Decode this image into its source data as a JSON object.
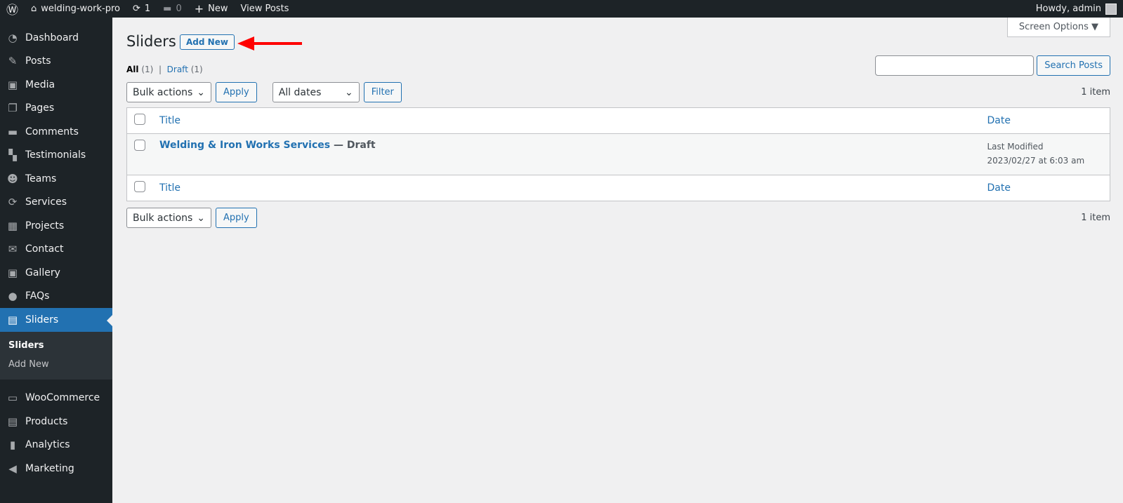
{
  "adminbar": {
    "site": "welding-work-pro",
    "updates": "1",
    "comments": "0",
    "new": "New",
    "view_posts": "View Posts",
    "howdy": "Howdy, admin"
  },
  "sidebar": {
    "items": [
      {
        "label": "Dashboard",
        "icon": "dashboard-icon",
        "glyph": "◔"
      },
      {
        "label": "Posts",
        "icon": "pin-icon",
        "glyph": "✎"
      },
      {
        "label": "Media",
        "icon": "media-icon",
        "glyph": "▣"
      },
      {
        "label": "Pages",
        "icon": "pages-icon",
        "glyph": "❐"
      },
      {
        "label": "Comments",
        "icon": "comment-icon",
        "glyph": "▬"
      },
      {
        "label": "Testimonials",
        "icon": "testimonials-icon",
        "glyph": "▚"
      },
      {
        "label": "Teams",
        "icon": "groups-icon",
        "glyph": "☻"
      },
      {
        "label": "Services",
        "icon": "update-icon",
        "glyph": "⟳"
      },
      {
        "label": "Projects",
        "icon": "portfolio-icon",
        "glyph": "▦"
      },
      {
        "label": "Contact",
        "icon": "email-icon",
        "glyph": "✉"
      },
      {
        "label": "Gallery",
        "icon": "gallery-icon",
        "glyph": "▣"
      },
      {
        "label": "FAQs",
        "icon": "chat-icon",
        "glyph": "●"
      },
      {
        "label": "Sliders",
        "icon": "slides-icon",
        "glyph": "▤"
      }
    ],
    "submenu": [
      "Sliders",
      "Add New"
    ],
    "items2": [
      {
        "label": "WooCommerce",
        "icon": "woo-icon",
        "glyph": "▭"
      },
      {
        "label": "Products",
        "icon": "archive-icon",
        "glyph": "▤"
      },
      {
        "label": "Analytics",
        "icon": "chart-bar-icon",
        "glyph": "▮"
      },
      {
        "label": "Marketing",
        "icon": "megaphone-icon",
        "glyph": "◀"
      }
    ]
  },
  "screen_options": "Screen Options ▼",
  "page": {
    "title": "Sliders",
    "add_new": "Add New"
  },
  "views": {
    "all": "All",
    "all_count": "(1)",
    "draft": "Draft",
    "draft_count": "(1)"
  },
  "search": {
    "button": "Search Posts",
    "value": ""
  },
  "filters": {
    "bulk": "Bulk actions",
    "apply": "Apply",
    "dates": "All dates",
    "filter": "Filter",
    "count": "1 item"
  },
  "table": {
    "col_title": "Title",
    "col_date": "Date",
    "rows": [
      {
        "title": "Welding & Iron Works Services",
        "state": " — Draft",
        "date_label": "Last Modified",
        "date": "2023/02/27 at 6:03 am"
      }
    ]
  },
  "colors": {
    "accent": "#2271b1",
    "arrow": "#ff0000"
  }
}
